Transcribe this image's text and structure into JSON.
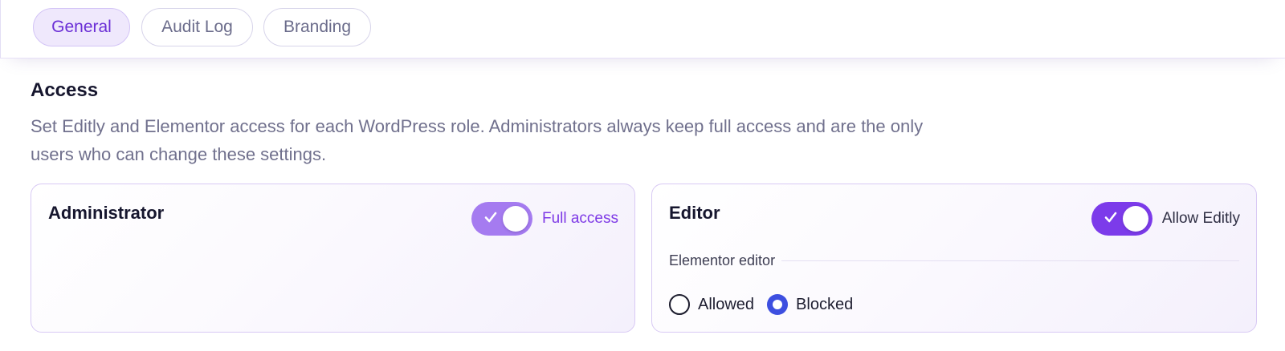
{
  "tabs": [
    {
      "label": "General",
      "active": true
    },
    {
      "label": "Audit Log",
      "active": false
    },
    {
      "label": "Branding",
      "active": false
    }
  ],
  "section": {
    "title": "Access",
    "description": "Set Editly and Elementor access for each WordPress role. Administrators always keep full access and are the only users who can change these settings."
  },
  "roles": [
    {
      "name": "Administrator",
      "toggle_label": "Full access",
      "toggle_on": true,
      "toggle_icon": "check-icon"
    },
    {
      "name": "Editor",
      "toggle_label": "Allow Editly",
      "toggle_on": true,
      "toggle_icon": "check-icon",
      "elementor": {
        "heading": "Elementor editor",
        "options": [
          "Allowed",
          "Blocked"
        ],
        "selected": "Blocked"
      }
    }
  ],
  "colors": {
    "accent": "#7c3bea",
    "accent_muted": "#a57bf0",
    "radio_selected": "#3d4fe0",
    "active_tab_bg": "#efe8fc",
    "active_tab_text": "#6b2fd6"
  }
}
